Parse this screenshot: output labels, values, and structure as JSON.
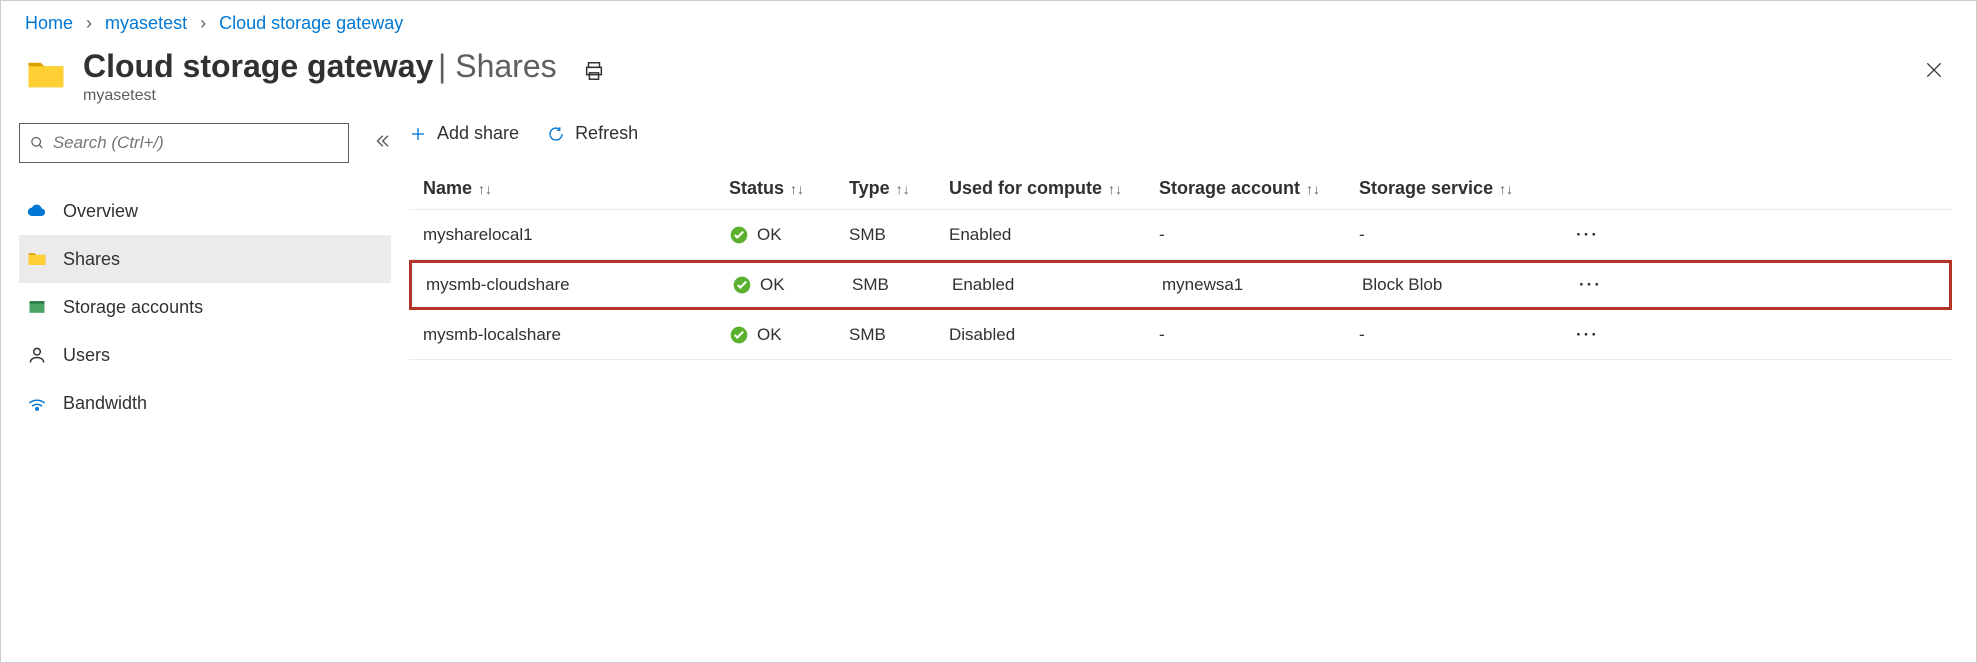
{
  "breadcrumb": {
    "items": [
      "Home",
      "myasetest",
      "Cloud storage gateway"
    ]
  },
  "header": {
    "title": "Cloud storage gateway",
    "subtitle": "Shares",
    "resource": "myasetest"
  },
  "sidebar": {
    "search_placeholder": "Search (Ctrl+/)",
    "items": [
      {
        "label": "Overview"
      },
      {
        "label": "Shares"
      },
      {
        "label": "Storage accounts"
      },
      {
        "label": "Users"
      },
      {
        "label": "Bandwidth"
      }
    ]
  },
  "toolbar": {
    "add_label": "Add share",
    "refresh_label": "Refresh"
  },
  "table": {
    "columns": {
      "name": "Name",
      "status": "Status",
      "type": "Type",
      "compute": "Used for compute",
      "account": "Storage account",
      "service": "Storage service"
    },
    "rows": [
      {
        "name": "mysharelocal1",
        "status": "OK",
        "type": "SMB",
        "compute": "Enabled",
        "account": "-",
        "service": "-",
        "highlight": false
      },
      {
        "name": "mysmb-cloudshare",
        "status": "OK",
        "type": "SMB",
        "compute": "Enabled",
        "account": "mynewsa1",
        "service": "Block Blob",
        "highlight": true
      },
      {
        "name": "mysmb-localshare",
        "status": "OK",
        "type": "SMB",
        "compute": "Disabled",
        "account": "-",
        "service": "-",
        "highlight": false
      }
    ]
  }
}
